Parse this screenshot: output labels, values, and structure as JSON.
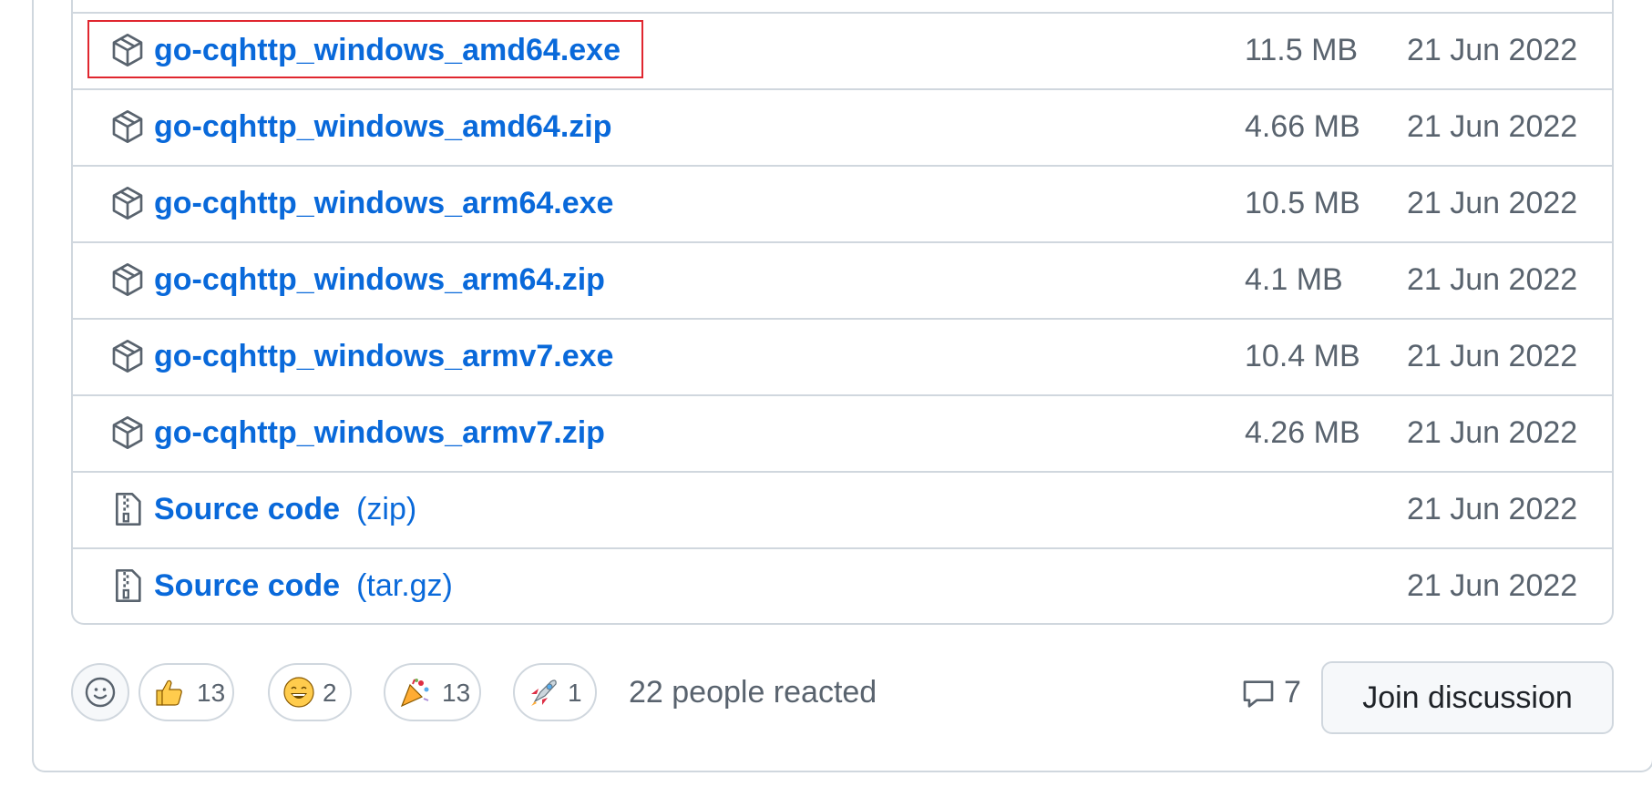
{
  "assets": [
    {
      "name": "go-cqhttp_windows_amd64.exe",
      "sub": "",
      "size": "11.5 MB",
      "date": "21 Jun 2022",
      "icon": "package-icon",
      "highlighted": true
    },
    {
      "name": "go-cqhttp_windows_amd64.zip",
      "sub": "",
      "size": "4.66 MB",
      "date": "21 Jun 2022",
      "icon": "package-icon"
    },
    {
      "name": "go-cqhttp_windows_arm64.exe",
      "sub": "",
      "size": "10.5 MB",
      "date": "21 Jun 2022",
      "icon": "package-icon"
    },
    {
      "name": "go-cqhttp_windows_arm64.zip",
      "sub": "",
      "size": "4.1 MB",
      "date": "21 Jun 2022",
      "icon": "package-icon"
    },
    {
      "name": "go-cqhttp_windows_armv7.exe",
      "sub": "",
      "size": "10.4 MB",
      "date": "21 Jun 2022",
      "icon": "package-icon"
    },
    {
      "name": "go-cqhttp_windows_armv7.zip",
      "sub": "",
      "size": "4.26 MB",
      "date": "21 Jun 2022",
      "icon": "package-icon"
    },
    {
      "name": "Source code",
      "sub": "(zip)",
      "size": "",
      "date": "21 Jun 2022",
      "icon": "file-zip-icon"
    },
    {
      "name": "Source code",
      "sub": "(tar.gz)",
      "size": "",
      "date": "21 Jun 2022",
      "icon": "file-zip-icon"
    }
  ],
  "reactions": {
    "items": [
      {
        "emoji": "thumbs-up",
        "count": "13"
      },
      {
        "emoji": "smile",
        "count": "2"
      },
      {
        "emoji": "tada",
        "count": "13"
      },
      {
        "emoji": "rocket",
        "count": "1"
      }
    ],
    "summary": "22 people reacted"
  },
  "discussion": {
    "comments_count": "7",
    "join_label": "Join discussion"
  },
  "colors": {
    "link": "#0969da",
    "muted": "#59636e",
    "border": "#d0d7de",
    "highlight": "#e0262f"
  }
}
